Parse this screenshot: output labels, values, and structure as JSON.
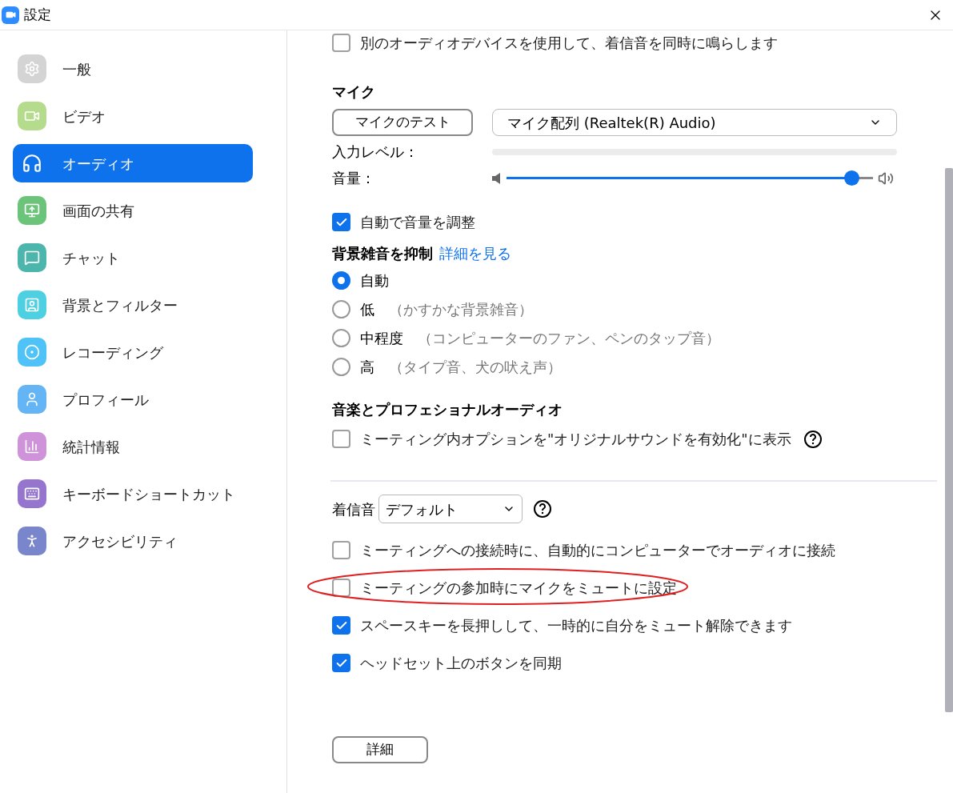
{
  "window": {
    "title": "設定"
  },
  "sidebar": {
    "items": [
      {
        "label": "一般",
        "selected": false
      },
      {
        "label": "ビデオ",
        "selected": false
      },
      {
        "label": "オーディオ",
        "selected": true
      },
      {
        "label": "画面の共有",
        "selected": false
      },
      {
        "label": "チャット",
        "selected": false
      },
      {
        "label": "背景とフィルター",
        "selected": false
      },
      {
        "label": "レコーディング",
        "selected": false
      },
      {
        "label": "プロフィール",
        "selected": false
      },
      {
        "label": "統計情報",
        "selected": false
      },
      {
        "label": "キーボードショートカット",
        "selected": false
      },
      {
        "label": "アクセシビリティ",
        "selected": false
      }
    ]
  },
  "top_option": {
    "label": "別のオーディオデバイスを使用して、着信音を同時に鳴らします",
    "checked": false
  },
  "mic": {
    "heading": "マイク",
    "test_button": "マイクのテスト",
    "device": "マイク配列 (Realtek(R) Audio)",
    "input_level_label": "入力レベル：",
    "volume_label": "音量：",
    "volume": {
      "level": 0.94
    }
  },
  "auto_volume": {
    "label": "自動で音量を調整",
    "checked": true
  },
  "noise": {
    "heading": "背景雑音を抑制",
    "link": "詳細を見る",
    "options": [
      {
        "label": "自動",
        "selected": true
      },
      {
        "label": "低",
        "note": "（かすかな背景雑音）",
        "selected": false
      },
      {
        "label": "中程度",
        "note": "（コンピューターのファン、ペンのタップ音）",
        "selected": false
      },
      {
        "label": "高",
        "note": "（タイプ音、犬の吠え声）",
        "selected": false
      }
    ]
  },
  "music": {
    "heading": "音楽とプロフェショナルオーディオ",
    "option": {
      "label": "ミーティング内オプションを\"オリジナルサウンドを有効化\"に表示",
      "checked": false
    }
  },
  "ringtone": {
    "label": "着信音",
    "value": "デフォルト"
  },
  "options": [
    {
      "label": "ミーティングへの接続時に、自動的にコンピューターでオーディオに接続",
      "checked": false,
      "highlighted": false
    },
    {
      "label": "ミーティングの参加時にマイクをミュートに設定",
      "checked": false,
      "highlighted": true
    },
    {
      "label": "スペースキーを長押しして、一時的に自分をミュート解除できます",
      "checked": true,
      "highlighted": false
    },
    {
      "label": "ヘッドセット上のボタンを同期",
      "checked": true,
      "highlighted": false
    }
  ],
  "advanced_button": "詳細"
}
